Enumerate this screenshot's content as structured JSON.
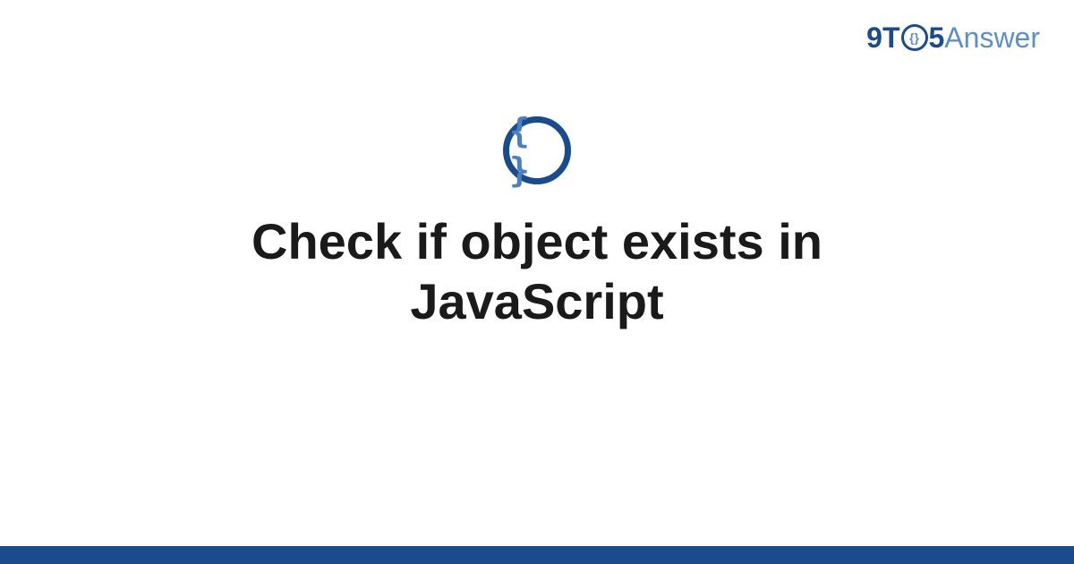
{
  "logo": {
    "prefix": "9T",
    "circle_glyph": "{}",
    "five": "5",
    "suffix": "Answer"
  },
  "icon": {
    "glyph": "{ }"
  },
  "main": {
    "title": "Check if object exists in JavaScript"
  }
}
